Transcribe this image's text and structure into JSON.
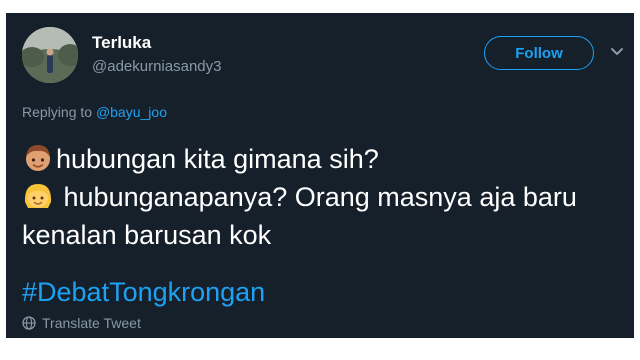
{
  "tweet": {
    "display_name": "Terluka",
    "handle": "@adekurniasandy3",
    "follow_label": "Follow",
    "reply_prefix": "Replying to",
    "reply_mention": "@bayu_joo",
    "line1": "hubungan kita gimana sih?",
    "line2": "hubunganapanya? Orang masnya aja baru",
    "line3": "kenalan barusan kok",
    "hashtag": "#DebatTongkrongan",
    "translate_label": "Translate Tweet"
  },
  "icons": {
    "avatar": "profile-photo",
    "menu": "chevron-down-icon",
    "emoji_boy": "boy-emoji-icon",
    "emoji_girl": "girl-emoji-icon",
    "translate": "globe-icon"
  },
  "colors": {
    "background": "#15202b",
    "accent": "#1da1f2",
    "secondary_text": "#8899a6",
    "primary_text": "#ffffff"
  }
}
